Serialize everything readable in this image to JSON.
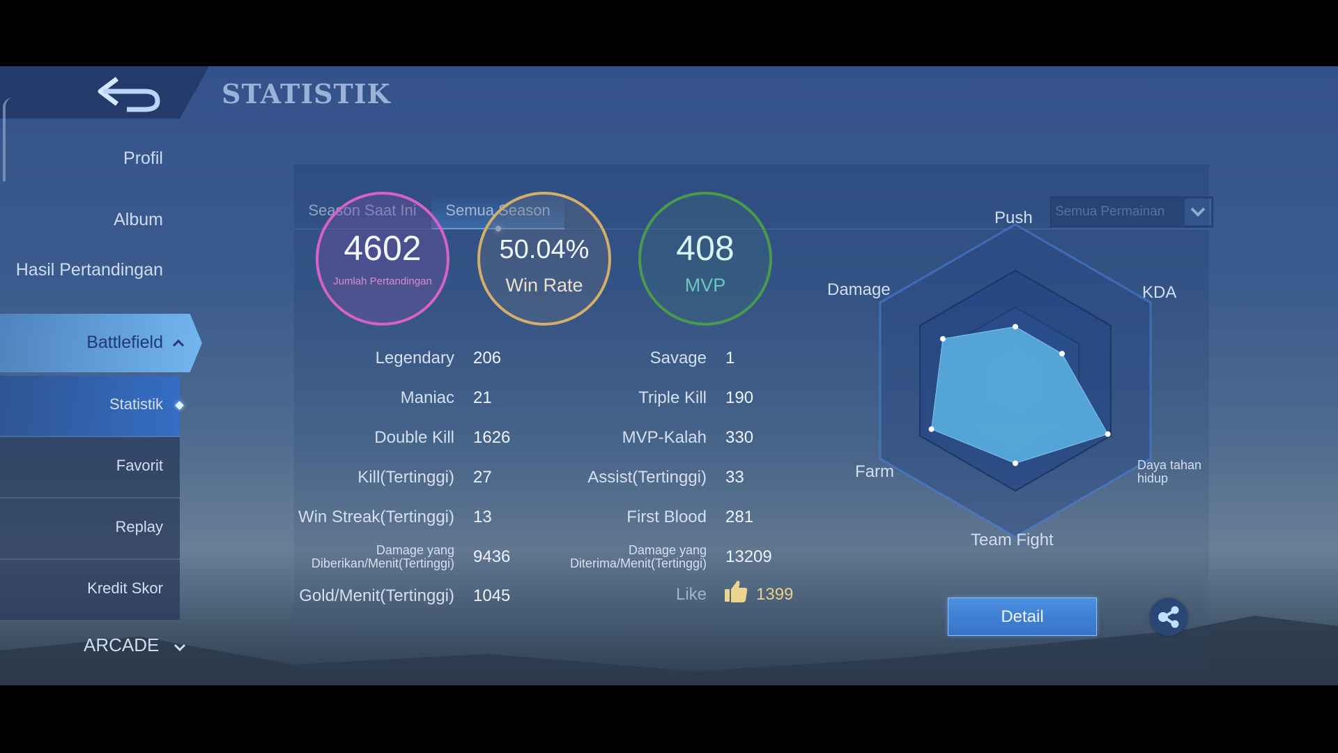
{
  "header": {
    "title": "STATISTIK",
    "back_icon": "back-arrow-icon"
  },
  "sidebar": {
    "items": [
      {
        "label": "Profil"
      },
      {
        "label": "Album"
      },
      {
        "label": "Hasil Pertandingan"
      },
      {
        "label": "Battlefield",
        "expanded": true
      }
    ],
    "sub_items": [
      {
        "label": "Statistik",
        "active": true
      },
      {
        "label": "Favorit"
      },
      {
        "label": "Replay"
      },
      {
        "label": "Kredit Skor"
      }
    ],
    "arcade": {
      "label": "ARCADE"
    }
  },
  "tabs": [
    {
      "label": "Season Saat Ini",
      "active": false
    },
    {
      "label": "Semua Season",
      "active": true
    }
  ],
  "filter": {
    "selected": "Semua Permainan"
  },
  "summary": {
    "matches": {
      "value": "4602",
      "label": "Jumlah Pertandingan",
      "color": "#d663c4"
    },
    "win_rate": {
      "value": "50.04%",
      "label": "Win Rate",
      "color": "#d2ae6a"
    },
    "mvp": {
      "value": "408",
      "label": "MVP",
      "color": "#4a9a4e"
    }
  },
  "stats_left": [
    {
      "label": "Legendary",
      "value": "206"
    },
    {
      "label": "Maniac",
      "value": "21"
    },
    {
      "label": "Double Kill",
      "value": "1626"
    },
    {
      "label": "Kill(Tertinggi)",
      "value": "27"
    },
    {
      "label": "Win Streak(Tertinggi)",
      "value": "13"
    },
    {
      "label": "Damage yang Diberikan/Menit(Tertinggi)",
      "label_line1": "Damage yang",
      "label_line2": "Diberikan/Menit(Tertinggi)",
      "value": "9436"
    },
    {
      "label": "Gold/Menit(Tertinggi)",
      "value": "1045"
    }
  ],
  "stats_right": [
    {
      "label": "Savage",
      "value": "1"
    },
    {
      "label": "Triple Kill",
      "value": "190"
    },
    {
      "label": "MVP-Kalah",
      "value": "330"
    },
    {
      "label": "Assist(Tertinggi)",
      "value": "33"
    },
    {
      "label": "First Blood",
      "value": "281"
    },
    {
      "label": "Damage yang Diterima/Menit(Tertinggi)",
      "label_line1": "Damage yang",
      "label_line2": "Diterima/Menit(Tertinggi)",
      "value": "13209"
    }
  ],
  "like": {
    "label": "Like",
    "value": "1399",
    "icon": "thumbs-up-icon",
    "color": "#e9d08a"
  },
  "chart_data": {
    "type": "radar",
    "title": "",
    "axes": [
      "Push",
      "KDA",
      "Daya tahan hidup",
      "Team Fight",
      "Farm",
      "Damage"
    ],
    "values": [
      0.49,
      0.49,
      0.97,
      0.75,
      0.88,
      0.76
    ],
    "range": [
      0,
      1
    ],
    "grid_levels": 3,
    "fill_color": "#5aaee0"
  },
  "buttons": {
    "detail": "Detail",
    "share_icon": "share-icon"
  }
}
